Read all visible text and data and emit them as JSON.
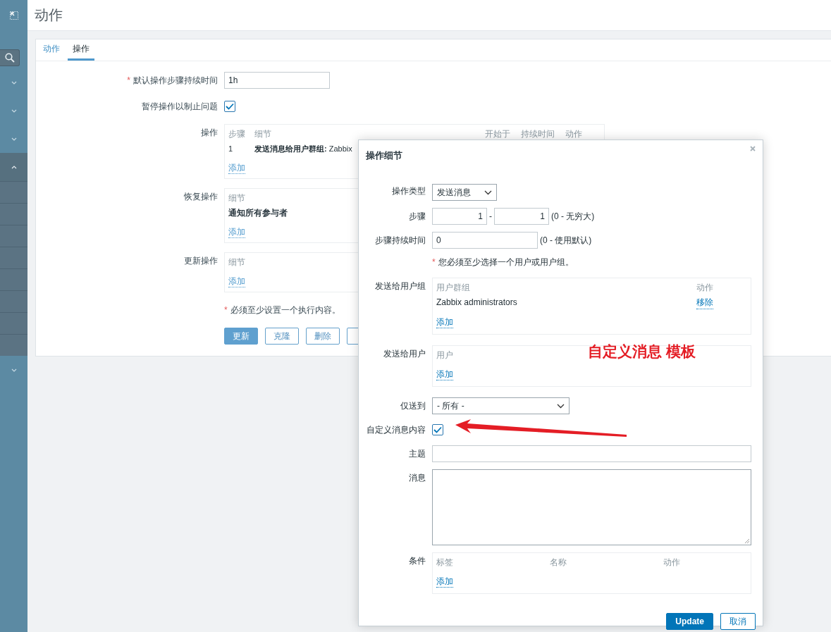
{
  "sidebar": {
    "menus": [
      {
        "expanded": false
      },
      {
        "expanded": false
      },
      {
        "expanded": false
      },
      {
        "expanded": true
      },
      {
        "expanded": false
      }
    ]
  },
  "page": {
    "title": "动作"
  },
  "tabs": [
    {
      "label": "动作",
      "selected": false
    },
    {
      "label": "操作",
      "selected": true
    }
  ],
  "form": [
    {
      "kind": "text",
      "required_mark": "*",
      "label": "默认操作步骤持续时间",
      "value": "1h"
    },
    {
      "kind": "checkbox",
      "label": "暂停操作以制止问题",
      "checked": true
    },
    {
      "kind": "table",
      "label": "操作",
      "columns": [
        "步骤",
        "细节",
        "开始于",
        "持续时间",
        "动作"
      ],
      "rows": [
        [
          "1",
          "**发送消息给用户群组:** Zabbix"
        ]
      ],
      "add": "添加"
    },
    {
      "kind": "table",
      "label": "恢复操作",
      "columns": [
        "细节"
      ],
      "rows": [
        [
          "通知所有参与者"
        ]
      ],
      "add": "添加"
    },
    {
      "kind": "table",
      "label": "更新操作",
      "columns": [
        "细节"
      ],
      "add": "添加"
    },
    {
      "kind": "note",
      "required_mark": "*",
      "text": "必须至少设置一个执行内容。"
    }
  ],
  "buttons": [
    {
      "label": "更新",
      "primary": true
    },
    {
      "label": "克隆",
      "primary": false
    },
    {
      "label": "删除",
      "primary": false
    },
    {
      "primary": false
    }
  ],
  "dialog": {
    "title": "操作细节",
    "rows": [
      {
        "kind": "select",
        "label": "操作类型",
        "value": "发送消息"
      },
      {
        "kind": "range",
        "label": "步骤",
        "from": "1",
        "separator": "-",
        "to": "1",
        "hint": "(0 - 无穷大)"
      },
      {
        "kind": "text",
        "label": "步骤持续时间",
        "value": "0",
        "hint": "(0 - 使用默认)"
      },
      {
        "kind": "note",
        "required_mark": "*",
        "text": "您必须至少选择一个用户或用户组。"
      },
      {
        "kind": "table",
        "label": "发送给用户组",
        "columns": [
          "用户群组",
          "动作"
        ],
        "rows": [
          {
            "cells": [
              "Zabbix administrators"
            ],
            "action": "移除"
          }
        ],
        "add": "添加"
      },
      {
        "kind": "table",
        "label": "发送给用户",
        "columns": [
          "用户"
        ],
        "add": "添加"
      },
      {
        "kind": "wide_select",
        "label": "仅送到",
        "value": "- 所有 -"
      },
      {
        "kind": "checkbox",
        "label": "自定义消息内容",
        "checked": true
      },
      {
        "kind": "wide_text",
        "label": "主题"
      },
      {
        "kind": "textarea",
        "label": "消息"
      },
      {
        "kind": "table",
        "label": "条件",
        "columns": [
          "标签",
          "名称",
          "动作"
        ],
        "add": "添加"
      }
    ],
    "buttons": [
      {
        "label": "Update",
        "primary": true
      },
      {
        "label": "取消",
        "primary": false
      }
    ]
  },
  "annotation": {
    "text": "自定义消息 模板"
  }
}
